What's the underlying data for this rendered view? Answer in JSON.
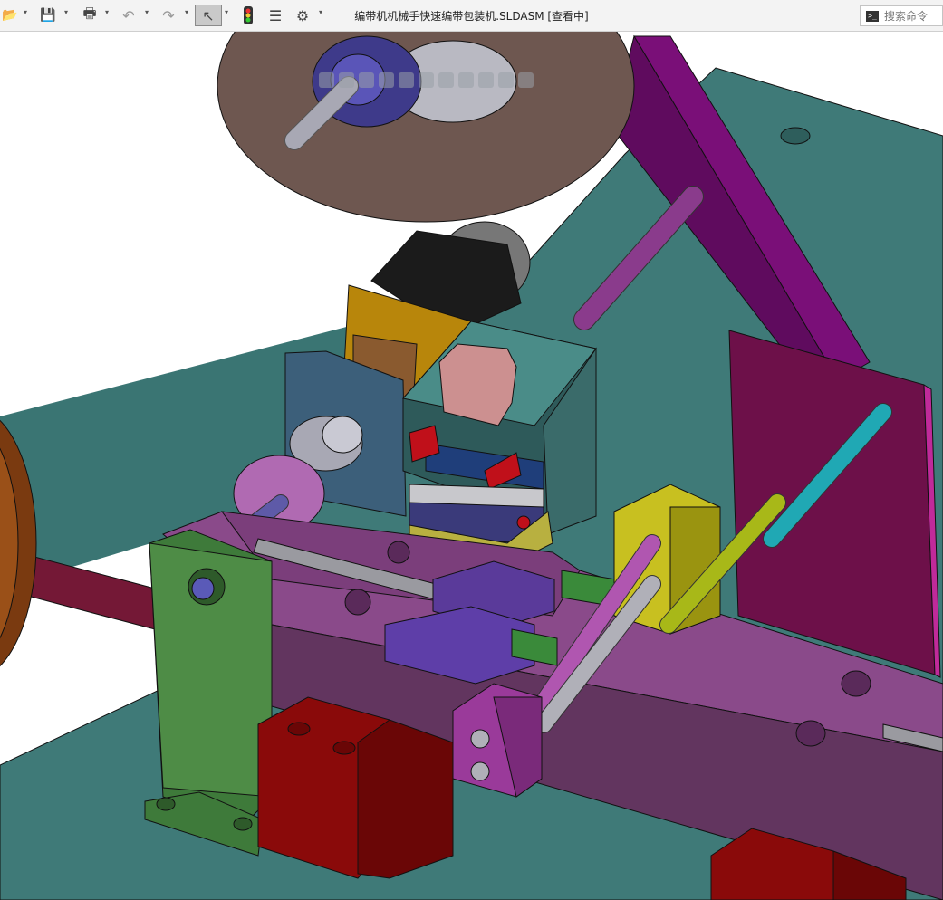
{
  "window": {
    "title": "编带机机械手快速编带包装机.SLDASM [查看中]"
  },
  "toolbar": {
    "items": [
      {
        "name": "open-icon",
        "glyph": "📂"
      },
      {
        "name": "save-icon",
        "glyph": "💾"
      },
      {
        "name": "print-icon",
        "glyph": "🖶"
      },
      {
        "name": "undo-icon",
        "glyph": "↶"
      },
      {
        "name": "redo-icon",
        "glyph": "↷"
      },
      {
        "name": "select-icon",
        "glyph": "↖"
      },
      {
        "name": "rebuild-icon",
        "glyph": "●"
      },
      {
        "name": "file-properties-icon",
        "glyph": "☰"
      },
      {
        "name": "options-icon",
        "glyph": "⚙"
      }
    ],
    "dropdown_glyph": "▾"
  },
  "search": {
    "prefix": ">_",
    "placeholder": "搜索命令"
  },
  "heads_up_toolbar": {
    "icons": [
      "zoom-to-fit-icon",
      "zoom-area-icon",
      "previous-view-icon",
      "section-view-icon",
      "view-orientation-icon",
      "display-style-icon",
      "hide-show-icon",
      "edit-appearance-icon",
      "apply-scene-icon",
      "view-settings-icon",
      "display-pane-icon"
    ]
  },
  "colors": {
    "teal_base": "#3f7a78",
    "purple_rail": "#62355f",
    "red_block": "#7a0a0a",
    "green_plate": "#3e7a3a",
    "magenta_panel": "#6d1049",
    "brown_reel": "#6e5750"
  }
}
